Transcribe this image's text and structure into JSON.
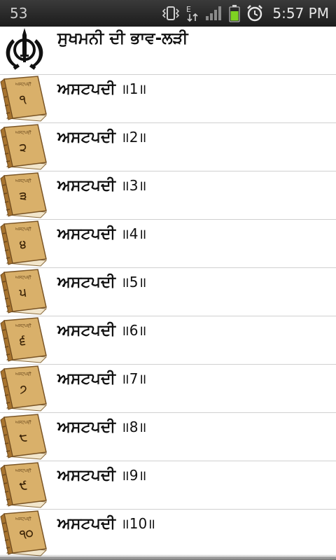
{
  "status_bar": {
    "notification_count": "53",
    "time": "5:57 PM",
    "icons": [
      "vibrate-icon",
      "edge-data-icon",
      "signal-icon",
      "battery-icon",
      "alarm-icon"
    ],
    "network_letter": "E"
  },
  "header": {
    "title": "ਸੁਖਮਨੀ ਦੀ ਭਾਵ-ਲੜੀ",
    "icon": "khanda-icon"
  },
  "items": [
    {
      "label": "ਅਸਟਪਦੀ",
      "number": "॥1॥",
      "book_numeral": "੧"
    },
    {
      "label": "ਅਸਟਪਦੀ",
      "number": "॥2॥",
      "book_numeral": "੨"
    },
    {
      "label": "ਅਸਟਪਦੀ",
      "number": "॥3॥",
      "book_numeral": "੩"
    },
    {
      "label": "ਅਸਟਪਦੀ",
      "number": "॥4॥",
      "book_numeral": "੪"
    },
    {
      "label": "ਅਸਟਪਦੀ",
      "number": "॥5॥",
      "book_numeral": "੫"
    },
    {
      "label": "ਅਸਟਪਦੀ",
      "number": "॥6॥",
      "book_numeral": "੬"
    },
    {
      "label": "ਅਸਟਪਦੀ",
      "number": "॥7॥",
      "book_numeral": "੭"
    },
    {
      "label": "ਅਸਟਪਦੀ",
      "number": "॥8॥",
      "book_numeral": "੮"
    },
    {
      "label": "ਅਸਟਪਦੀ",
      "number": "॥9॥",
      "book_numeral": "੯"
    },
    {
      "label": "ਅਸਟਪਦੀ",
      "number": "॥10॥",
      "book_numeral": "੧੦"
    }
  ],
  "book_header_text": "ਅਸਟਪਦੀ",
  "colors": {
    "book_cover": "#d9b06a",
    "book_spine": "#a8742f",
    "divider": "#d0d0d0"
  }
}
